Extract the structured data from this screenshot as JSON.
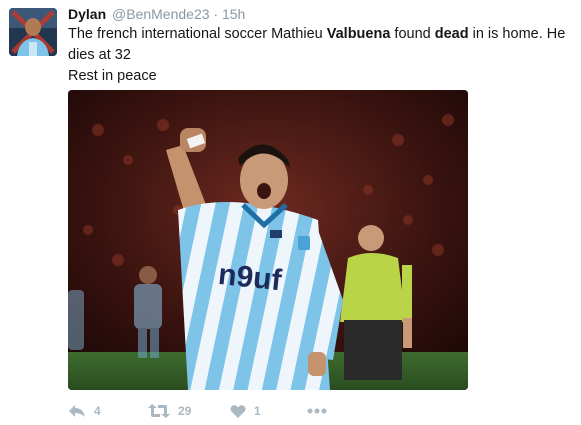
{
  "tweet": {
    "display_name": "Dylan",
    "handle": "@BenMende23",
    "separator": "·",
    "time": "15h",
    "text": {
      "part1": "The french international soccer Mathieu ",
      "bold1": "Valbuena",
      "part2": " found ",
      "bold2": "dead",
      "part3": " in is home. He dies at 32",
      "line2": "Rest in peace"
    },
    "media": {
      "shirt_sponsor": "n9uf"
    },
    "actions": {
      "reply_count": "4",
      "retweet_count": "29",
      "like_count": "1"
    }
  },
  "colors": {
    "text": "#14171a",
    "muted": "#8899a6",
    "action_icon": "#aab8c2"
  }
}
